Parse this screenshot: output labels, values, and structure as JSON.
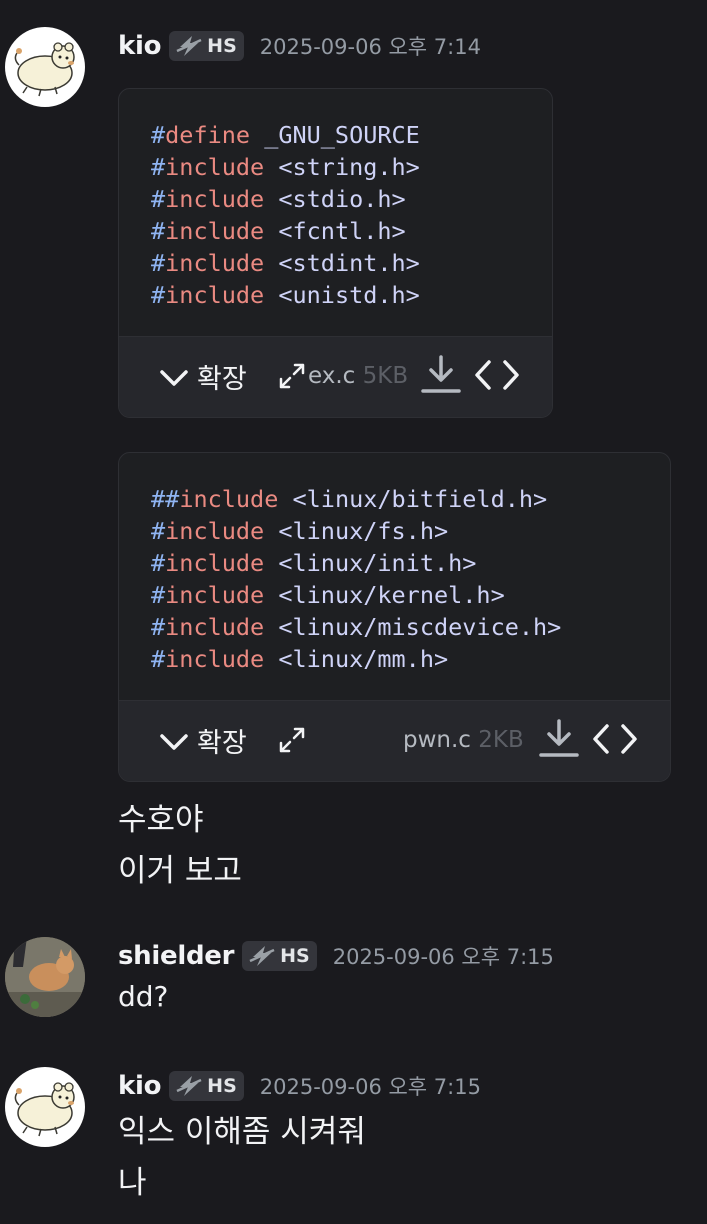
{
  "messages": [
    {
      "username": "kio",
      "tag": "HS",
      "timestamp": "2025-09-06 오후 7:14",
      "avatar_icon": "bear-sticker-icon",
      "attachments": [
        {
          "code_lines": [
            [
              "#define",
              " _GNU_SOURCE"
            ],
            [
              "#include",
              " <string.h>"
            ],
            [
              "#include",
              " <stdio.h>"
            ],
            [
              "#include",
              " <fcntl.h>"
            ],
            [
              "#include",
              " <stdint.h>"
            ],
            [
              "#include",
              " <unistd.h>"
            ]
          ],
          "expand_label": "확장",
          "filename": "ex.c",
          "filesize": "5KB"
        },
        {
          "code_lines": [
            [
              "#include",
              " <linux/bitfield.h>"
            ],
            [
              "#include",
              " <linux/fs.h>"
            ],
            [
              "#include",
              " <linux/init.h>"
            ],
            [
              "#include",
              " <linux/kernel.h>"
            ],
            [
              "#include",
              " <linux/miscdevice.h>"
            ],
            [
              "#include",
              " <linux/mm.h>"
            ]
          ],
          "expand_label": "확장",
          "filename": "pwn.c",
          "filesize": "2KB"
        }
      ],
      "lines": [
        "수호야",
        "이거 보고"
      ]
    },
    {
      "username": "shielder",
      "tag": "HS",
      "timestamp": "2025-09-06 오후 7:15",
      "avatar_icon": "cat-photo-icon",
      "lines": [
        "dd?"
      ]
    },
    {
      "username": "kio",
      "tag": "HS",
      "timestamp": "2025-09-06 오후 7:15",
      "avatar_icon": "bear-sticker-icon",
      "lines": [
        "익스 이해좀 시켜줘",
        "나"
      ]
    }
  ],
  "colors": {
    "background": "#1a1a1e",
    "code_directive": "#ea8a82",
    "code_hash": "#8fb4f2",
    "code_text": "#cfd3f7",
    "timestamp": "#949ba4"
  }
}
